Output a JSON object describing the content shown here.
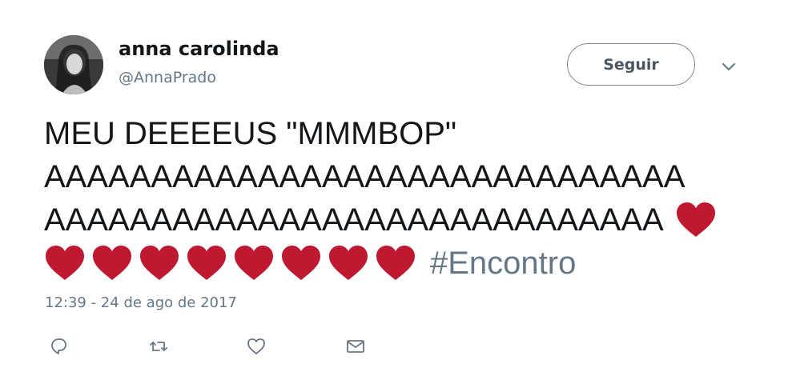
{
  "tweet": {
    "user": {
      "display_name": "anna carolinda",
      "handle": "@AnnaPrado",
      "avatar_icon": "profile-photo"
    },
    "follow_label": "Seguir",
    "text_line_1": "MEU DEEEEUS \"MMMBOP\"",
    "text_line_2": "AAAAAAAAAAAAAAAAAAAAAAAAAAAAAA",
    "text_line_3": "AAAAAAAAAAAAAAAAAAAAAAAAAAAAA",
    "hashtag": "#Encontro",
    "emoji": "red-heart",
    "emoji_color": "#be1931",
    "timestamp": "12:39 - 24 de ago de 2017",
    "actions": [
      "reply-icon",
      "retweet-icon",
      "like-icon",
      "direct-message-icon"
    ]
  }
}
